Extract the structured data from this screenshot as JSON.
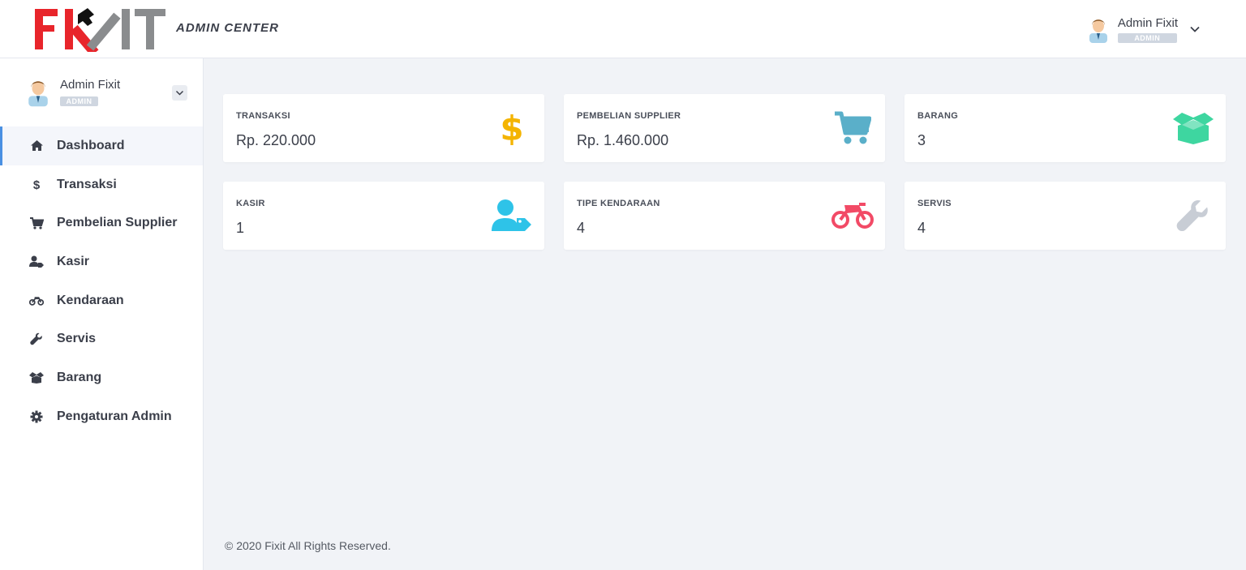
{
  "header": {
    "logo_text": "FIXIT",
    "subtitle": "ADMIN CENTER",
    "user_name": "Admin Fixit",
    "user_role": "ADMIN"
  },
  "sidebar": {
    "user_name": "Admin Fixit",
    "user_role": "ADMIN",
    "items": [
      {
        "label": "Dashboard",
        "icon": "home-icon",
        "active": true
      },
      {
        "label": "Transaksi",
        "icon": "dollar-icon"
      },
      {
        "label": "Pembelian Supplier",
        "icon": "cart-icon"
      },
      {
        "label": "Kasir",
        "icon": "user-tag-icon"
      },
      {
        "label": "Kendaraan",
        "icon": "motorcycle-icon"
      },
      {
        "label": "Servis",
        "icon": "wrench-icon"
      },
      {
        "label": "Barang",
        "icon": "box-open-icon"
      },
      {
        "label": "Pengaturan Admin",
        "icon": "gear-icon"
      }
    ]
  },
  "cards": [
    {
      "title": "TRANSAKSI",
      "value": "Rp. 220.000",
      "icon": "dollar-icon",
      "color": "#f4b400"
    },
    {
      "title": "PEMBELIAN SUPPLIER",
      "value": "Rp. 1.460.000",
      "icon": "cart-icon",
      "color": "#5aafc9"
    },
    {
      "title": "BARANG",
      "value": "3",
      "icon": "box-open-icon",
      "color": "#3ed6a0"
    },
    {
      "title": "KASIR",
      "value": "1",
      "icon": "user-tag-icon",
      "color": "#2ec3e8"
    },
    {
      "title": "TIPE KENDARAAN",
      "value": "4",
      "icon": "motorcycle-icon",
      "color": "#f24a66"
    },
    {
      "title": "SERVIS",
      "value": "4",
      "icon": "wrench-icon",
      "color": "#c8cdd5"
    }
  ],
  "footer": {
    "text": "© 2020 Fixit All Rights Reserved."
  },
  "colors": {
    "accent": "#4a90e2",
    "logo_red": "#e8252b",
    "logo_gray": "#8a8c8e"
  }
}
